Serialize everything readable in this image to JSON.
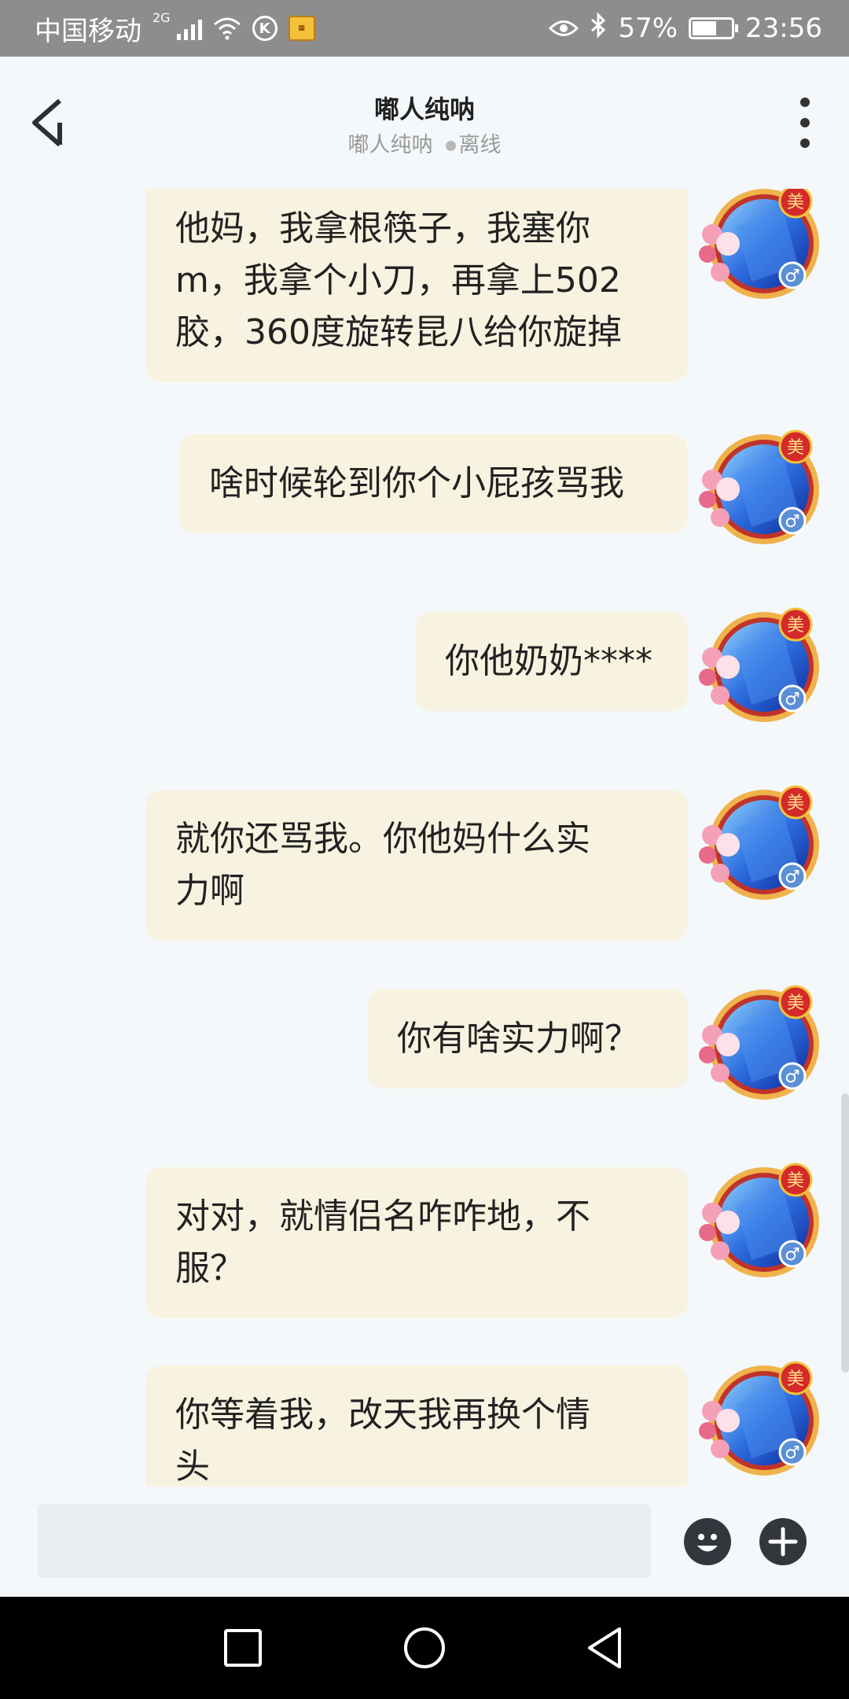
{
  "status_bar": {
    "carrier": "中国移动",
    "network": "2G",
    "battery_percent": "57%",
    "battery_level": 0.57,
    "time": "23:56",
    "icons": [
      "signal-icon",
      "wifi-icon",
      "k-app-icon",
      "app-badge-icon",
      "eye-icon",
      "bluetooth-icon",
      "battery-icon"
    ]
  },
  "header": {
    "title": "嘟人纯呐",
    "subtitle_name": "嘟人纯呐",
    "presence": "离线",
    "back_icon": "chevron-left-icon",
    "more_icon": "more-vertical-icon"
  },
  "messages": [
    {
      "text": "他妈，我拿根筷子，我塞你\nm，我拿个小刀，再拿上502\n胶，360度旋转昆八给你旋掉"
    },
    {
      "text": "啥时候轮到你个小屁孩骂我"
    },
    {
      "text": "你他奶奶****"
    },
    {
      "text": "就你还骂我。你他妈什么实\n力啊"
    },
    {
      "text": "你有啥实力啊？"
    },
    {
      "text": "对对，就情侣名咋咋地，不\n服？"
    },
    {
      "text": "你等着我，改天我再换个情\n头"
    }
  ],
  "avatar": {
    "badge_char": "美",
    "gender_symbol": "♂"
  },
  "input_bar": {
    "placeholder": "",
    "emoji_icon": "emoji-icon",
    "plus_icon": "plus-icon"
  },
  "colors": {
    "bubble": "#f8f3e1",
    "background": "#f4f8fb",
    "status_bar": "#8d8d8d",
    "nav_bar": "#000000"
  }
}
